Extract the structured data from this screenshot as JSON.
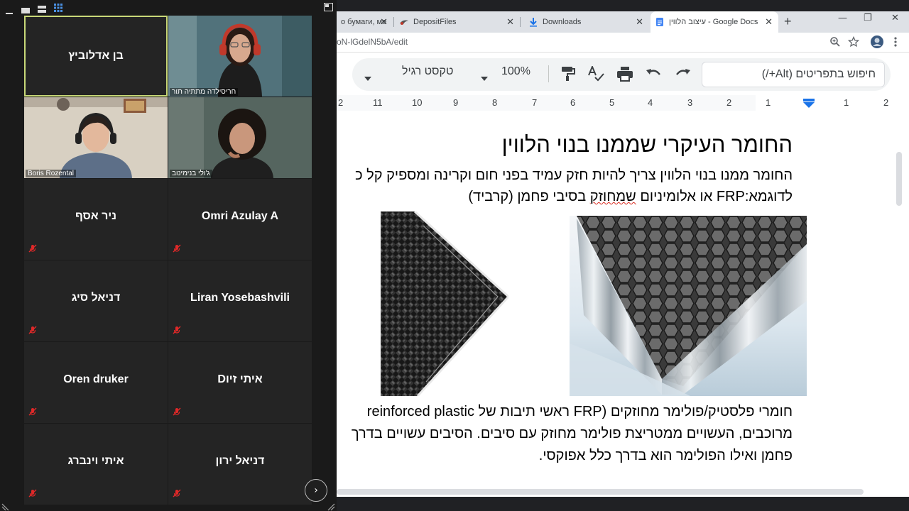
{
  "browser": {
    "tabs": [
      {
        "title": "о бумаги, ме",
        "icon": "doc-icon",
        "active": false
      },
      {
        "title": "DepositFiles",
        "icon": "depositfiles-icon",
        "active": false
      },
      {
        "title": "Downloads",
        "icon": "download-icon",
        "active": false
      },
      {
        "title": "עיצוב הלווין - Google Docs",
        "icon": "google-docs-icon",
        "active": true
      }
    ],
    "new_tab": "+",
    "url": "oN-lGdelN5bA/edit",
    "window_controls": {
      "minimize": "—",
      "restore": "❐",
      "close": "✕"
    }
  },
  "docs_toolbar": {
    "menu_search_placeholder": "חיפוש בתפריטים (Alt+/)",
    "zoom": "100%",
    "style": "טקסט רגיל"
  },
  "ruler": {
    "numbers": [
      "2",
      "11",
      "10",
      "9",
      "8",
      "7",
      "6",
      "5",
      "4",
      "3",
      "2",
      "1",
      "1",
      "2"
    ]
  },
  "document": {
    "heading": "החומר העיקרי שממנו בנוי הלווין",
    "para1_line1": "החומר ממנו בנוי הלווין צריך להיות חזק עמיד בפני חום וקרינה ומספיק קל כ",
    "para1_line2_a": "לדוגמא:FRP או אלומיניום ",
    "para1_line2_spell": "שמחוזק",
    "para1_line2_b": " בסיבי פחמן (קרביד)",
    "para2_line1": "חומרי פלסטיק/פולימר מחוזקים (FRP ראשי תיבות של reinforced plastic",
    "para2_line2": "מרוכבים, העשויים ממטריצת פולימר מחוזק עם סיבים. הסיבים עשויים בדרך",
    "para2_line3": "פחמן ואילו הפולימר הוא בדרך כלל אפוקסי."
  },
  "zoom": {
    "participants": [
      {
        "name": "בן אדלוביץ",
        "video": false,
        "muted": false,
        "speaking": true
      },
      {
        "name": "חריסילדה מתתיה תור",
        "video": true,
        "muted": false
      },
      {
        "name": "Boris Rozental",
        "video": true,
        "muted": false
      },
      {
        "name": "ג'ולי בנימינוב",
        "video": true,
        "muted": false
      },
      {
        "name": "ניר אסף",
        "video": false,
        "muted": true
      },
      {
        "name": "Omri Azulay A",
        "video": false,
        "muted": true
      },
      {
        "name": "דניאל סיג",
        "video": false,
        "muted": true
      },
      {
        "name": "Liran Yosebashvili",
        "video": false,
        "muted": true
      },
      {
        "name": "Oren druker",
        "video": false,
        "muted": true
      },
      {
        "name": "Dאיתי זיו",
        "video": false,
        "muted": true
      },
      {
        "name": "איתי וינברג",
        "video": false,
        "muted": true
      },
      {
        "name": "דניאל ירון",
        "video": false,
        "muted": true
      }
    ],
    "next_page": "›"
  },
  "colors": {
    "speaking_border": "#c8d878",
    "muted_red": "#e02828",
    "docs_blue": "#1a73e8"
  }
}
